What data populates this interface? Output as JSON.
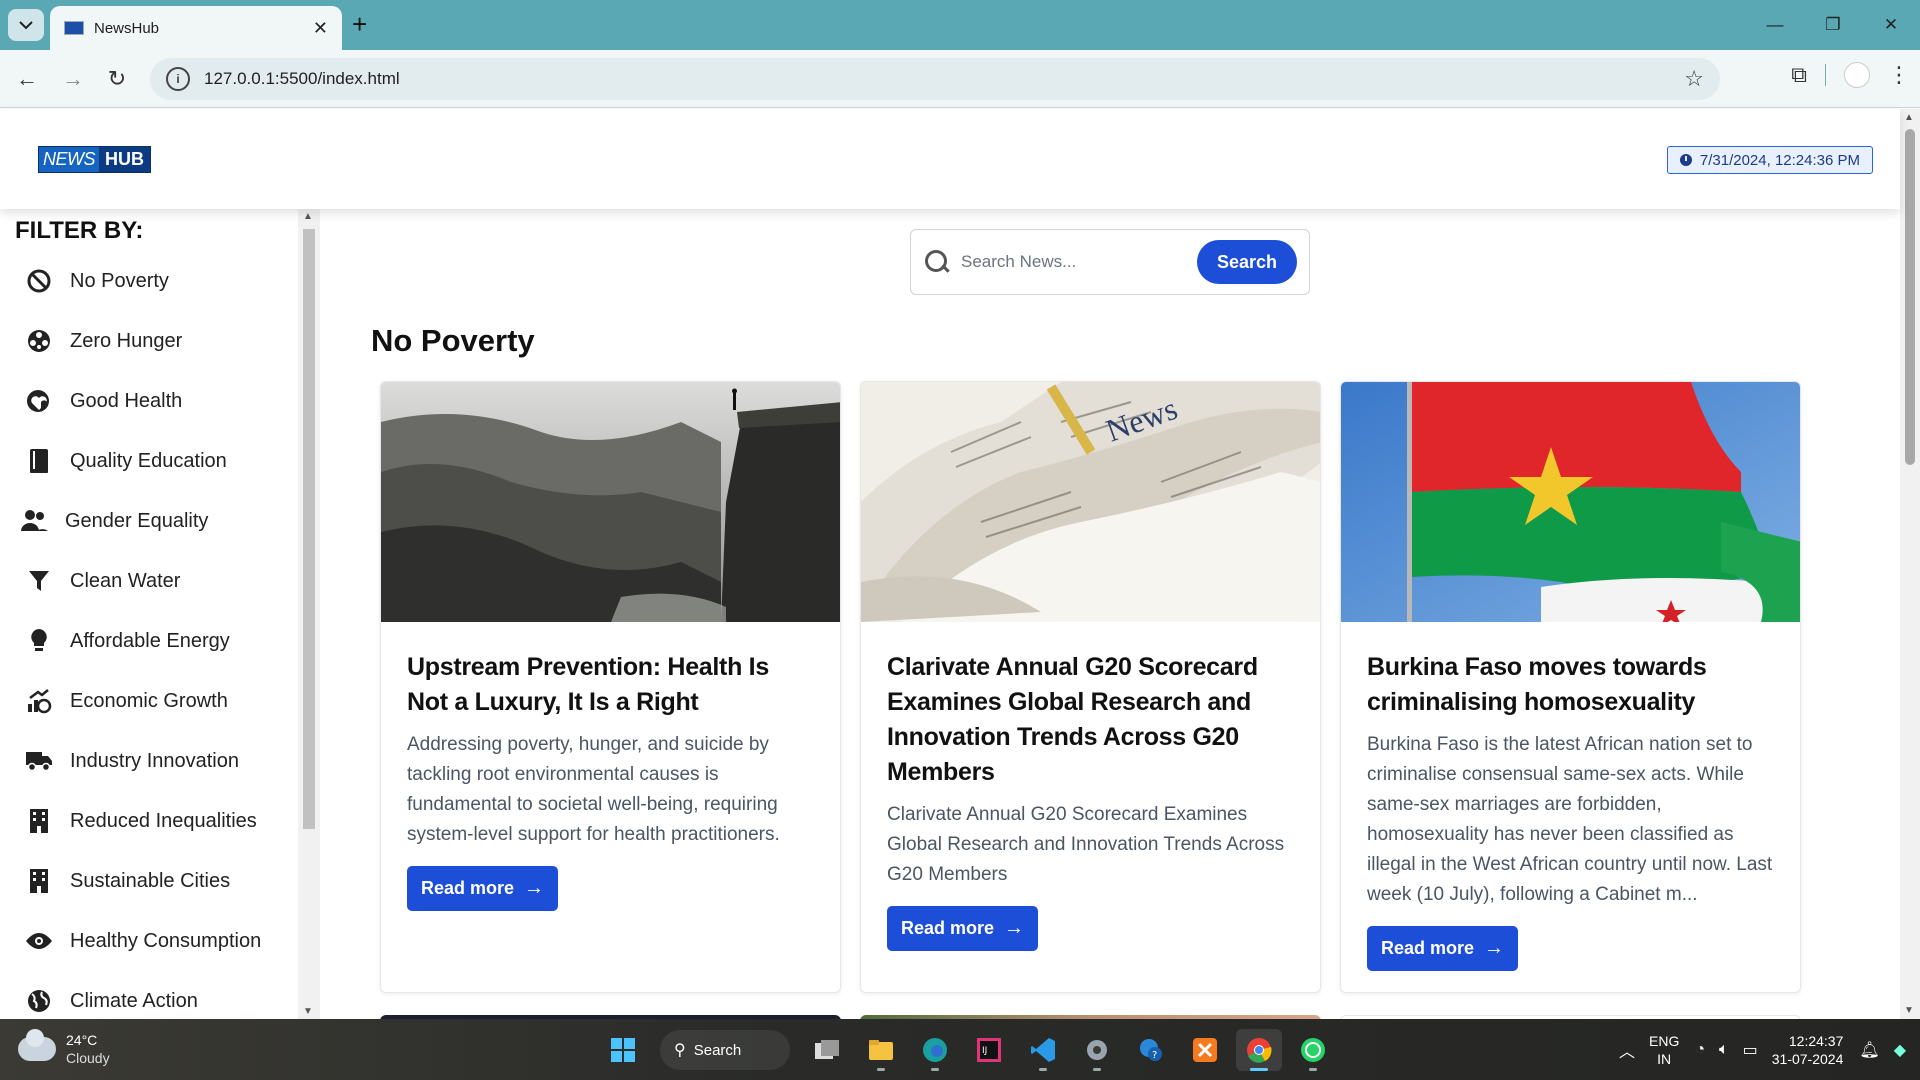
{
  "browser": {
    "tab_title": "NewsHub",
    "url": "127.0.0.1:5500/index.html"
  },
  "header": {
    "logo_news": "NEWS",
    "logo_hub": "HUB",
    "datetime": "7/31/2024, 12:24:36 PM"
  },
  "sidebar": {
    "title": "FILTER BY:",
    "items": [
      {
        "label": "No Poverty",
        "icon": "ban-icon"
      },
      {
        "label": "Zero Hunger",
        "icon": "food-icon"
      },
      {
        "label": "Good Health",
        "icon": "heart-health-icon"
      },
      {
        "label": "Quality Education",
        "icon": "book-icon"
      },
      {
        "label": "Gender Equality",
        "icon": "people-icon"
      },
      {
        "label": "Clean Water",
        "icon": "filter-icon"
      },
      {
        "label": "Affordable Energy",
        "icon": "lightbulb-icon"
      },
      {
        "label": "Economic Growth",
        "icon": "growth-icon"
      },
      {
        "label": "Industry Innovation",
        "icon": "truck-icon"
      },
      {
        "label": "Reduced Inequalities",
        "icon": "building-icon"
      },
      {
        "label": "Sustainable Cities",
        "icon": "city-icon"
      },
      {
        "label": "Healthy Consumption",
        "icon": "eye-icon"
      },
      {
        "label": "Climate Action",
        "icon": "globe-icon"
      }
    ]
  },
  "search": {
    "placeholder": "Search News...",
    "button": "Search"
  },
  "section": {
    "title": "No Poverty"
  },
  "cards": [
    {
      "title": "Upstream Prevention: Health Is Not a Luxury, It Is a Right",
      "description": "Addressing poverty, hunger, and suicide by tackling root environmental causes is fundamental to societal well-being, requiring system-level support for health practitioners.",
      "button": "Read more"
    },
    {
      "title": "Clarivate Annual G20 Scorecard Examines Global Research and Innovation Trends Across G20 Members",
      "description": "Clarivate Annual G20 Scorecard Examines Global Research and Innovation Trends Across G20 Members",
      "button": "Read more"
    },
    {
      "title": "Burkina Faso moves towards criminalising homosexuality",
      "description": "Burkina Faso is the latest African nation set to criminalise consensual same-sex acts. While same-sex marriages are forbidden, homosexuality has never been classified as illegal in the West African country until now. Last week (10 July), following a Cabinet m...",
      "button": "Read more"
    }
  ],
  "taskbar": {
    "temperature": "24°C",
    "condition": "Cloudy",
    "search_label": "Search",
    "lang_top": "ENG",
    "lang_bottom": "IN",
    "time": "12:24:37",
    "date": "31-07-2024"
  },
  "colors": {
    "primary": "#1d4ed8",
    "browser_frame": "#5aa8b4"
  }
}
